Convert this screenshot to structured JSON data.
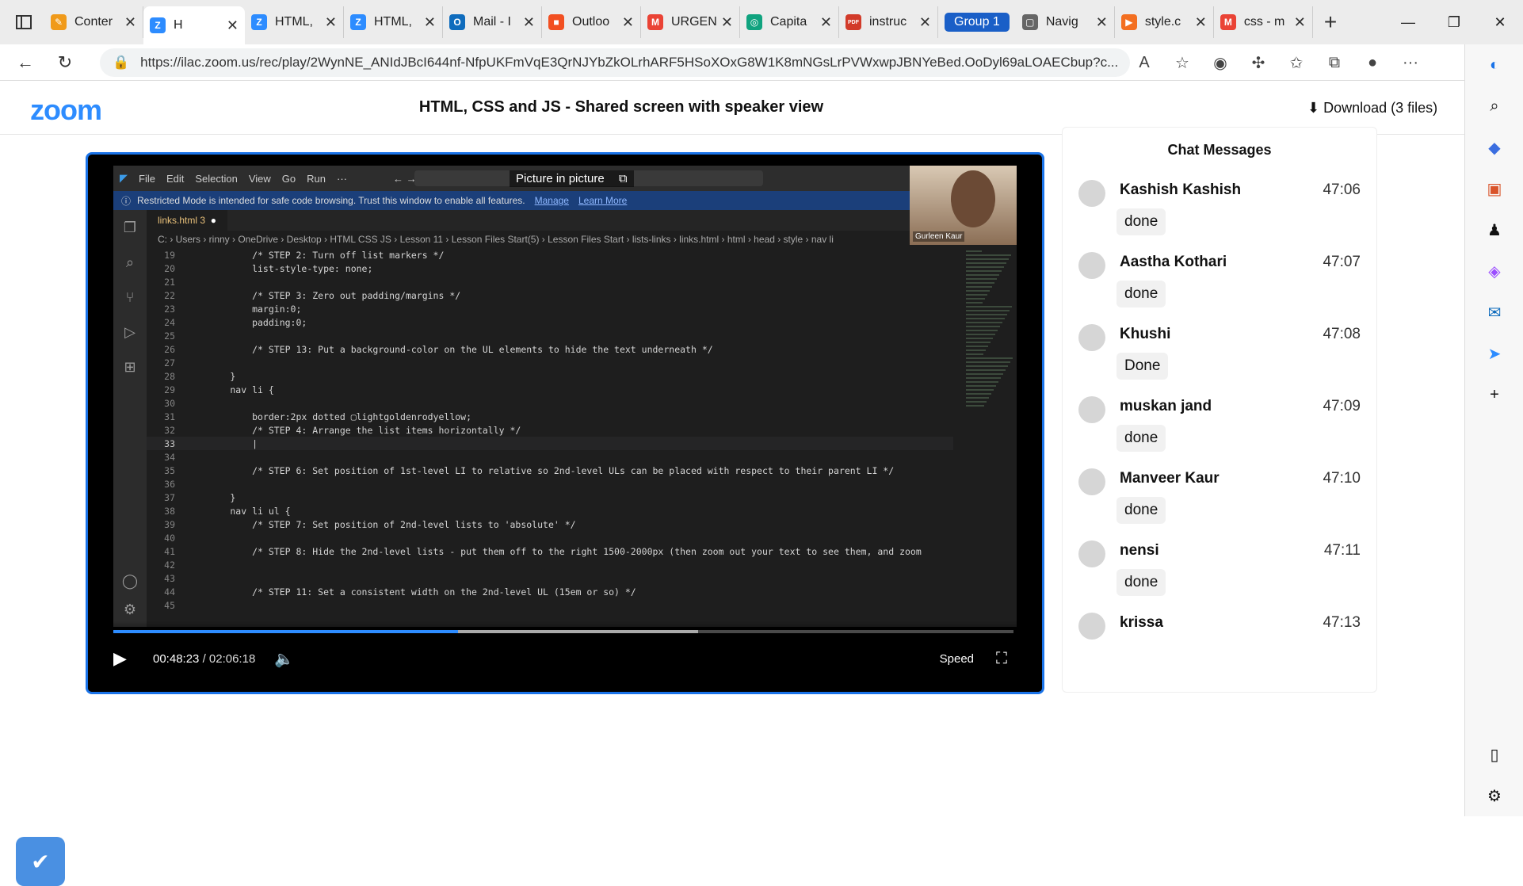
{
  "browser": {
    "tabs": [
      {
        "title": "Conter",
        "fav": "✎",
        "color": "#f09a1a",
        "w": 125
      },
      {
        "title": "H",
        "fav": "Z",
        "color": "#2d8cff",
        "active": true,
        "w": 128
      },
      {
        "title": "HTML,",
        "fav": "Z",
        "color": "#2d8cff",
        "w": 125
      },
      {
        "title": "HTML,",
        "fav": "Z",
        "color": "#2d8cff",
        "w": 125
      },
      {
        "title": "Mail - I",
        "fav": "O",
        "color": "#0f6cbd",
        "w": 125
      },
      {
        "title": "Outloo",
        "fav": "■",
        "color": "#f25022",
        "w": 125
      },
      {
        "title": "URGEN",
        "fav": "M",
        "color": "#ea4335",
        "w": 125
      },
      {
        "title": "Capita",
        "fav": "◎",
        "color": "#10a37f",
        "w": 125
      },
      {
        "title": "instruc",
        "fav": "PDF",
        "color": "#d23b2a",
        "w": 125
      }
    ],
    "group_label": "Group 1",
    "tabs_after": [
      {
        "title": "Navig",
        "fav": "▢",
        "color": "#666",
        "w": 125
      },
      {
        "title": "style.c",
        "fav": "▶",
        "color": "#f36f21",
        "w": 125
      },
      {
        "title": "css - m",
        "fav": "M",
        "color": "#ea4335",
        "w": 125
      }
    ],
    "url": "https://ilac.zoom.us/rec/play/2WynNE_ANIdJBcI644nf-NfpUKFmVqE3QrNJYbZkOLrhARF5HSoXOxG8W1K8mNGsLrPVWxwpJBNYeBed.OoDyl69aLOAECbup?c..."
  },
  "zoom": {
    "logo": "zoom",
    "title": "HTML, CSS and JS - Shared screen with speaker view",
    "download": "Download (3 files)"
  },
  "video": {
    "vscode_menu": [
      "File",
      "Edit",
      "Selection",
      "View",
      "Go",
      "Run",
      "···"
    ],
    "pip_label": "Picture in picture",
    "banner": "Restricted Mode is intended for safe code browsing. Trust this window to enable all features.",
    "banner_manage": "Manage",
    "banner_learn": "Learn More",
    "tab_name": "links.html 3",
    "breadcrumb": "C: › Users › rinny › OneDrive › Desktop › HTML CSS JS › Lesson 11 › Lesson Files Start(5) › Lesson Files Start › lists-links › links.html › html › head › style › nav li",
    "speaker": "Gurleen Kaur",
    "current_time": "00:48:23",
    "total_time": "/ 02:06:18",
    "progress": 0.383,
    "speed_label": "Speed",
    "code": [
      {
        "n": "19",
        "t": "            /* STEP 2: Turn off list markers */",
        "k": "c-com"
      },
      {
        "n": "20",
        "t": "            list-style-type: none;",
        "k": "c-prop"
      },
      {
        "n": "21",
        "t": "",
        "k": ""
      },
      {
        "n": "22",
        "t": "            /* STEP 3: Zero out padding/margins */",
        "k": "c-com"
      },
      {
        "n": "23",
        "t": "            margin:0;",
        "k": "c-prop"
      },
      {
        "n": "24",
        "t": "            padding:0;",
        "k": "c-prop"
      },
      {
        "n": "25",
        "t": "",
        "k": ""
      },
      {
        "n": "26",
        "t": "            /* STEP 13: Put a background-color on the UL elements to hide the text underneath */",
        "k": "c-com"
      },
      {
        "n": "27",
        "t": "",
        "k": ""
      },
      {
        "n": "28",
        "t": "        }",
        "k": ""
      },
      {
        "n": "29",
        "t": "        nav li {",
        "k": "c-sel"
      },
      {
        "n": "30",
        "t": "",
        "k": ""
      },
      {
        "n": "31",
        "t": "            border:2px dotted ▢lightgoldenrodyellow;",
        "k": "c-val"
      },
      {
        "n": "32",
        "t": "            /* STEP 4: Arrange the list items horizontally */",
        "k": "c-com"
      },
      {
        "n": "33",
        "t": "            |",
        "k": "",
        "cur": true
      },
      {
        "n": "34",
        "t": "",
        "k": ""
      },
      {
        "n": "35",
        "t": "            /* STEP 6: Set position of 1st-level LI to relative so 2nd-level ULs can be placed with respect to their parent LI */",
        "k": "c-com"
      },
      {
        "n": "36",
        "t": "",
        "k": ""
      },
      {
        "n": "37",
        "t": "        }",
        "k": ""
      },
      {
        "n": "38",
        "t": "        nav li ul {",
        "k": "c-sel"
      },
      {
        "n": "39",
        "t": "            /* STEP 7: Set position of 2nd-level lists to 'absolute' */",
        "k": "c-com"
      },
      {
        "n": "40",
        "t": "",
        "k": ""
      },
      {
        "n": "41",
        "t": "            /* STEP 8: Hide the 2nd-level lists - put them off to the right 1500-2000px (then zoom out your text to see them, and zoom",
        "k": "c-com"
      },
      {
        "n": "42",
        "t": "",
        "k": ""
      },
      {
        "n": "43",
        "t": "",
        "k": ""
      },
      {
        "n": "44",
        "t": "            /* STEP 11: Set a consistent width on the 2nd-level UL (15em or so) */",
        "k": "c-com"
      },
      {
        "n": "45",
        "t": "",
        "k": ""
      }
    ]
  },
  "chat": {
    "title": "Chat Messages",
    "messages": [
      {
        "name": "Kashish Kashish",
        "time": "47:06",
        "text": "done"
      },
      {
        "name": "Aastha Kothari",
        "time": "47:07",
        "text": "done"
      },
      {
        "name": "Khushi",
        "time": "47:08",
        "text": "Done"
      },
      {
        "name": "muskan jand",
        "time": "47:09",
        "text": "done"
      },
      {
        "name": "Manveer Kaur",
        "time": "47:10",
        "text": "done"
      },
      {
        "name": "nensi",
        "time": "47:11",
        "text": "done"
      },
      {
        "name": "krissa",
        "time": "47:13",
        "text": ""
      }
    ]
  }
}
